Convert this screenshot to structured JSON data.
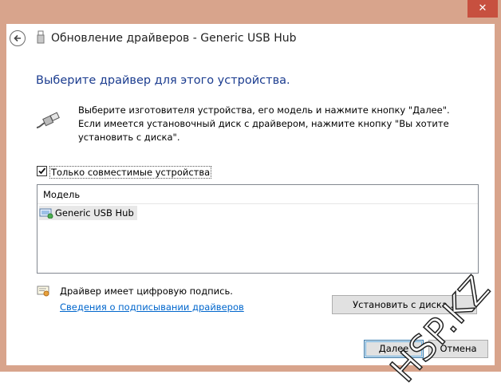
{
  "window": {
    "title": "Обновление драйверов - Generic USB Hub",
    "close_label": "✕"
  },
  "main": {
    "heading": "Выберите драйвер для этого устройства.",
    "instructions": "Выберите изготовителя устройства, его модель и нажмите кнопку \"Далее\". Если имеется установочный диск с  драйвером, нажмите кнопку \"Вы хотите установить с диска\".",
    "compatible_checkbox": {
      "label": "Только совместимые устройства",
      "checked": true
    },
    "list": {
      "column_header": "Модель",
      "items": [
        "Generic USB Hub"
      ]
    },
    "signature_text": "Драйвер имеет цифровую подпись.",
    "signature_link": "Сведения о подписывании драйверов",
    "install_disk_button": "Установить с диска..."
  },
  "footer": {
    "next_button": "Далее",
    "cancel_button": "Отмена"
  },
  "watermark": "HSP.KZ",
  "colors": {
    "frame": "#d8a48c",
    "close": "#c7503f",
    "heading": "#1b3c8f",
    "link": "#0066cc"
  }
}
